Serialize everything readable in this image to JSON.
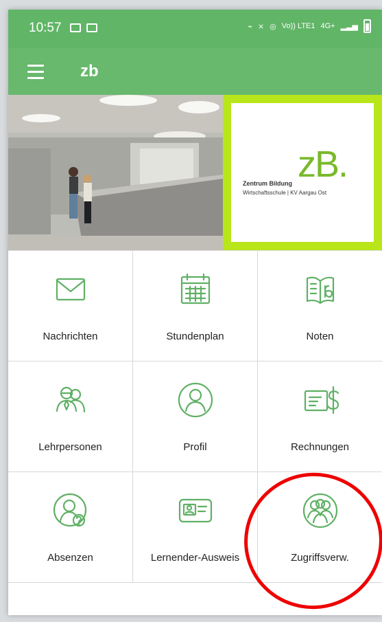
{
  "status": {
    "time": "10:57",
    "net_label": "Vo)) LTE1",
    "network": "4G+"
  },
  "appbar": {
    "title": "zb",
    "menu_icon": "hamburger-menu-icon"
  },
  "hero": {
    "logo_mark": "zB.",
    "logo_name": "Zentrum Bildung",
    "logo_sub": "Wirtschaftsschule | KV Aargau Ost"
  },
  "tiles": [
    {
      "label": "Nachrichten",
      "icon": "envelope-icon"
    },
    {
      "label": "Stundenplan",
      "icon": "calendar-icon"
    },
    {
      "label": "Noten",
      "icon": "book-icon"
    },
    {
      "label": "Lehrpersonen",
      "icon": "teacher-icon"
    },
    {
      "label": "Profil",
      "icon": "person-icon"
    },
    {
      "label": "Rechnungen",
      "icon": "invoice-icon"
    },
    {
      "label": "Absenzen",
      "icon": "person-question-icon"
    },
    {
      "label": "Lernender-Ausweis",
      "icon": "id-card-icon"
    },
    {
      "label": "Zugriffsverw.",
      "icon": "group-icon"
    }
  ],
  "colors": {
    "statusbar": "#61b567",
    "appbar": "#68b86d",
    "accent_green": "#5fb064",
    "logo_frame": "#b8e61a",
    "annotation": "#ee0000"
  }
}
